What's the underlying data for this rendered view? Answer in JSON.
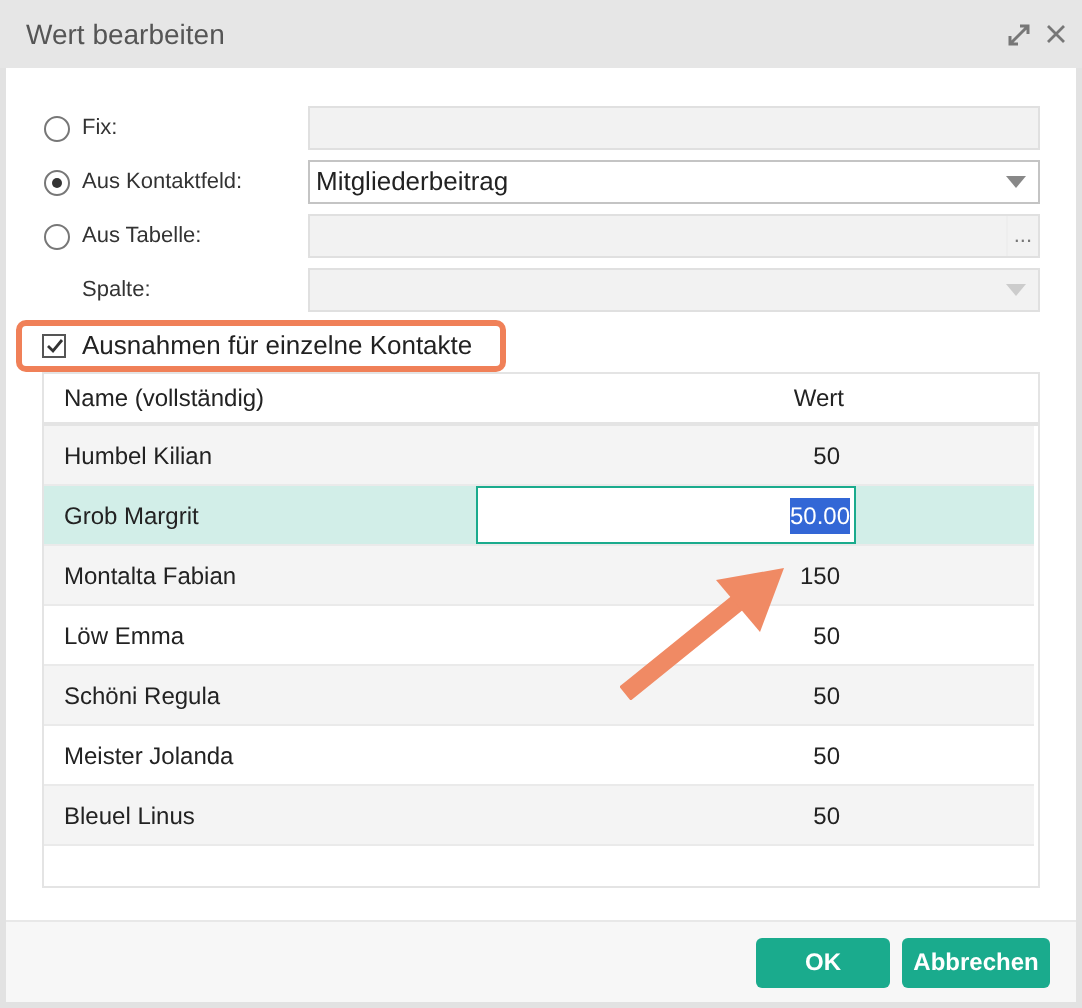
{
  "window": {
    "title": "Wert bearbeiten"
  },
  "options": [
    {
      "kind": "radio",
      "label": "Fix:",
      "selected": false,
      "field": {
        "kind": "text",
        "disabled": true
      }
    },
    {
      "kind": "radio",
      "label": "Aus Kontaktfeld:",
      "selected": true,
      "field": {
        "kind": "dropdown",
        "value": "Mitgliederbeitrag",
        "disabled": false
      }
    },
    {
      "kind": "radio",
      "label": "Aus Tabelle:",
      "selected": false,
      "field": {
        "kind": "picker",
        "button": "...",
        "disabled": true
      }
    },
    {
      "kind": "plain",
      "label": "Spalte:",
      "field": {
        "kind": "dropdown",
        "disabled": true
      }
    }
  ],
  "exceptions": {
    "label": "Ausnahmen für einzelne Kontakte",
    "checked": true,
    "highlighted": true
  },
  "table": {
    "columns": [
      "Name (vollständig)",
      "Wert"
    ],
    "rows": [
      {
        "name": "Humbel Kilian",
        "value": "50",
        "selected": false,
        "editing": false
      },
      {
        "name": "Grob Margrit",
        "value": "50.00",
        "selected": true,
        "editing": true
      },
      {
        "name": "Montalta Fabian",
        "value": "150",
        "selected": false,
        "editing": false
      },
      {
        "name": "Löw Emma",
        "value": "50",
        "selected": false,
        "editing": false
      },
      {
        "name": "Schöni Regula",
        "value": "50",
        "selected": false,
        "editing": false
      },
      {
        "name": "Meister Jolanda",
        "value": "50",
        "selected": false,
        "editing": false
      },
      {
        "name": "Bleuel Linus",
        "value": "50",
        "selected": false,
        "editing": false
      }
    ]
  },
  "annotation": {
    "kind": "arrow"
  },
  "buttons": [
    "OK",
    "Abbrechen"
  ]
}
